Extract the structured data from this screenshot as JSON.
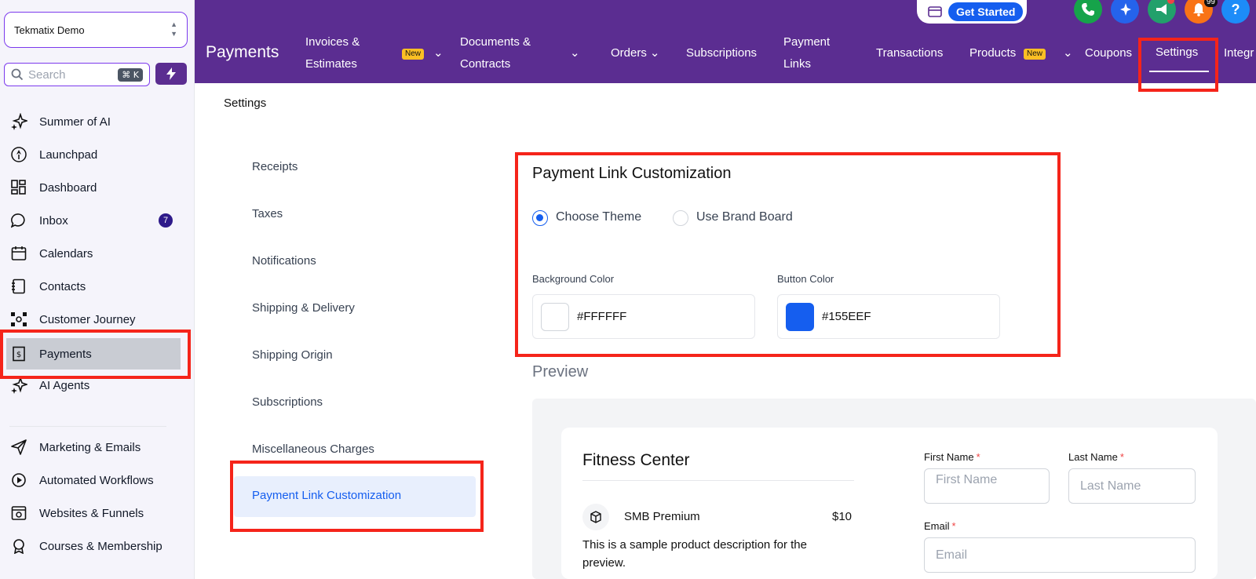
{
  "sidebar": {
    "account": "Tekmatix Demo",
    "search_placeholder": "Search",
    "search_shortcut": "⌘ K",
    "items": [
      {
        "label": "Summer of AI"
      },
      {
        "label": "Launchpad"
      },
      {
        "label": "Dashboard"
      },
      {
        "label": "Inbox",
        "badge": "7"
      },
      {
        "label": "Calendars"
      },
      {
        "label": "Contacts"
      },
      {
        "label": "Customer Journey"
      },
      {
        "label": "Payments"
      },
      {
        "label": "AI Agents"
      },
      {
        "label": "Marketing & Emails"
      },
      {
        "label": "Automated Workflows"
      },
      {
        "label": "Websites & Funnels"
      },
      {
        "label": "Courses & Membership"
      }
    ]
  },
  "topbar": {
    "get_started": "Get Started",
    "notification_count": "99",
    "help": "?",
    "section_title": "Payments",
    "tabs": [
      {
        "line1": "Invoices &",
        "line2": "Estimates"
      },
      {
        "line1": "Documents &",
        "line2": "Contracts"
      },
      {
        "label": "Orders"
      },
      {
        "label": "Subscriptions"
      },
      {
        "line1": "Payment",
        "line2": "Links"
      },
      {
        "label": "Transactions"
      },
      {
        "label": "Products"
      },
      {
        "label": "Coupons"
      },
      {
        "label": "Settings"
      },
      {
        "label": "Integr"
      }
    ],
    "new_badge": "New"
  },
  "breadcrumb": "Settings",
  "settings_menu": [
    "Receipts",
    "Taxes",
    "Notifications",
    "Shipping & Delivery",
    "Shipping Origin",
    "Subscriptions",
    "Miscellaneous Charges",
    "Payment Link Customization"
  ],
  "customization": {
    "title": "Payment Link Customization",
    "theme_option": "Choose Theme",
    "brand_option": "Use Brand Board",
    "bg_label": "Background Color",
    "bg_value": "#FFFFFF",
    "btn_label": "Button Color",
    "btn_value": "#155EEF"
  },
  "preview": {
    "title": "Preview",
    "shop_name": "Fitness Center",
    "product_name": "SMB Premium",
    "product_price": "$10",
    "product_desc": "This is a sample product description for the preview.",
    "first_name_label": "First Name",
    "first_name_placeholder": "First Name",
    "last_name_label": "Last Name",
    "last_name_placeholder": "Last Name",
    "email_label": "Email",
    "email_placeholder": "Email",
    "required_mark": "*"
  },
  "colors": {
    "brand_purple": "#5B2D91",
    "accent_blue": "#155EEF",
    "highlight_red": "#F5241A"
  }
}
